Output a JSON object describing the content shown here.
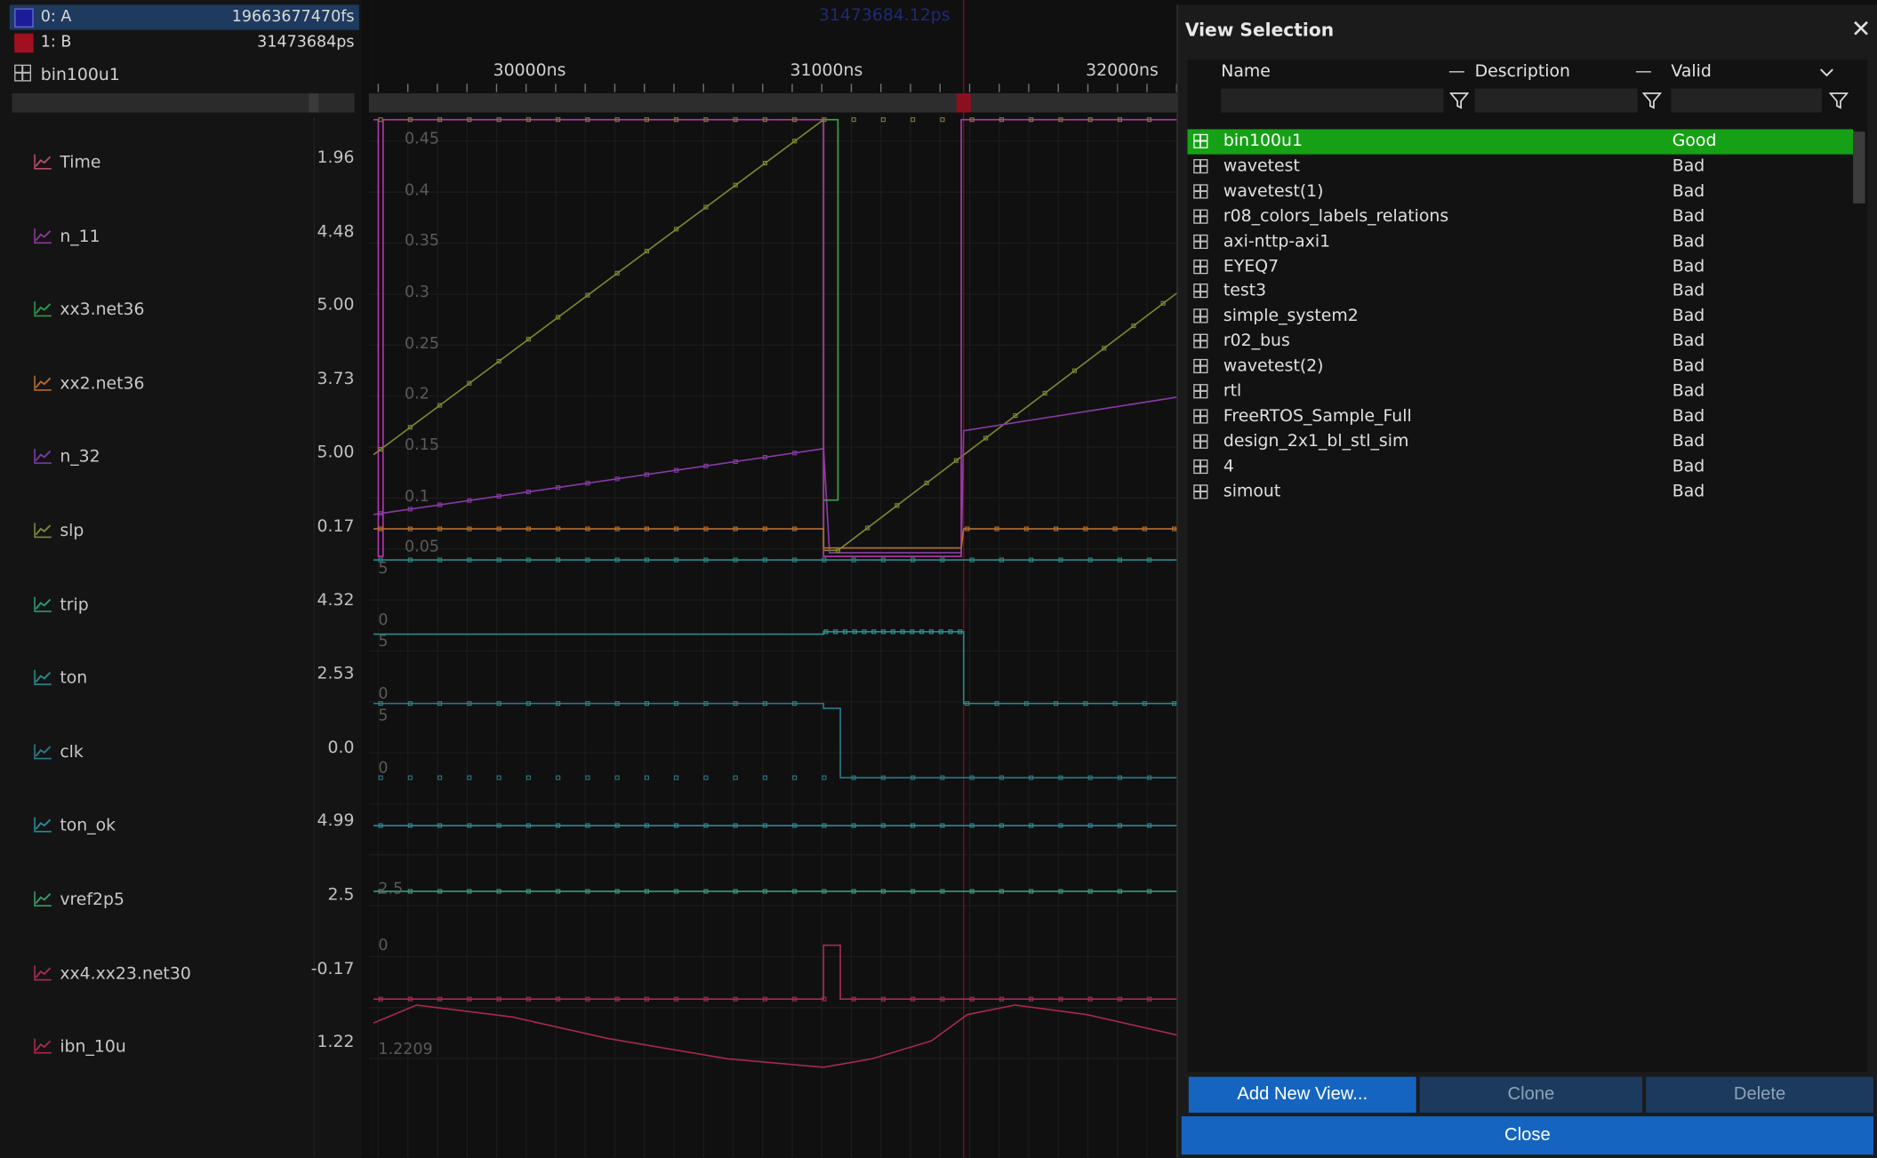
{
  "cursors": [
    {
      "name": "0: A",
      "time": "19663677470fs",
      "color": "#2a2aa8"
    },
    {
      "name": "1: B",
      "time": "31473684ps",
      "color": "#a01020"
    }
  ],
  "view_name": "bin100u1",
  "timeline": {
    "labels": [
      "30000ns",
      "31000ns",
      "32000ns"
    ],
    "cursor_readout": "31473684.12ps"
  },
  "signals": [
    {
      "name": "Time",
      "value": "1.96",
      "color": "#b84a6a"
    },
    {
      "name": "n_11",
      "value": "4.48",
      "color": "#8a3a9a"
    },
    {
      "name": "xx3.net36",
      "value": "5.00",
      "color": "#2a9a4a"
    },
    {
      "name": "xx2.net36",
      "value": "3.73",
      "color": "#b86a2a"
    },
    {
      "name": "n_32",
      "value": "5.00",
      "color": "#7a3aa8"
    },
    {
      "name": "slp",
      "value": "0.17",
      "color": "#7a8a3a"
    },
    {
      "name": "trip",
      "value": "4.32",
      "color": "#2a9a7a"
    },
    {
      "name": "ton",
      "value": "2.53",
      "color": "#2a8a8a"
    },
    {
      "name": "clk",
      "value": "0.0",
      "color": "#2a7a8a"
    },
    {
      "name": "ton_ok",
      "value": "4.99",
      "color": "#2a8a9a"
    },
    {
      "name": "vref2p5",
      "value": "2.5",
      "color": "#3a9a6a"
    },
    {
      "name": "xx4.xx23.net30",
      "value": "-0.17",
      "color": "#a82a5a"
    },
    {
      "name": "ibn_10u",
      "value": "1.22",
      "color": "#a82a4a"
    }
  ],
  "axis_labels": {
    "slp": [
      "0.45",
      "0.4",
      "0.35",
      "0.3",
      "0.25",
      "0.2",
      "0.15",
      "0.1",
      "0.05"
    ],
    "lanes": [
      "5",
      "0",
      "5",
      "0",
      "5",
      "0",
      "2.5",
      "0",
      "1.2209"
    ]
  },
  "dialog": {
    "title": "View Selection",
    "close_icon": "close-icon",
    "columns": {
      "name": "Name",
      "description": "Description",
      "valid": "Valid"
    },
    "rows": [
      {
        "name": "bin100u1",
        "valid": "Good",
        "selected": true
      },
      {
        "name": "wavetest",
        "valid": "Bad"
      },
      {
        "name": "wavetest(1)",
        "valid": "Bad"
      },
      {
        "name": "r08_colors_labels_relations",
        "valid": "Bad"
      },
      {
        "name": "axi-nttp-axi1",
        "valid": "Bad"
      },
      {
        "name": "EYEQ7",
        "valid": "Bad"
      },
      {
        "name": "test3",
        "valid": "Bad"
      },
      {
        "name": "simple_system2",
        "valid": "Bad"
      },
      {
        "name": "r02_bus",
        "valid": "Bad"
      },
      {
        "name": "wavetest(2)",
        "valid": "Bad"
      },
      {
        "name": "rtl",
        "valid": "Bad"
      },
      {
        "name": "FreeRTOS_Sample_Full",
        "valid": "Bad"
      },
      {
        "name": "design_2x1_bl_stl_sim",
        "valid": "Bad"
      },
      {
        "name": "4",
        "valid": "Bad"
      },
      {
        "name": "simout",
        "valid": "Bad"
      }
    ],
    "buttons": {
      "add": "Add New View...",
      "clone": "Clone",
      "delete": "Delete",
      "close": "Close"
    },
    "accent": "#1565c0",
    "good_color": "#16a016"
  }
}
